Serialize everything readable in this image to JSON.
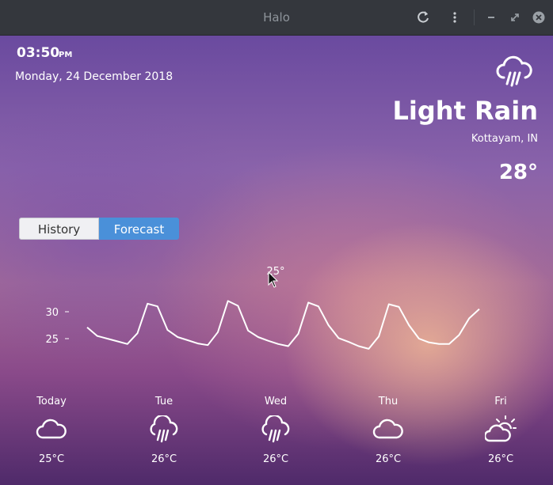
{
  "window": {
    "title": "Halo"
  },
  "header": {
    "time": "03:50",
    "ampm": "PM",
    "date": "Monday, 24 December 2018",
    "condition": "Light Rain",
    "location": "Kottayam, IN",
    "temperature": "28°",
    "condition_icon": "rain-cloud-icon"
  },
  "tabs": [
    {
      "label": "History",
      "active": false
    },
    {
      "label": "Forecast",
      "active": true
    }
  ],
  "chart_data": {
    "type": "line",
    "title": "",
    "xlabel": "",
    "ylabel": "",
    "yticks": [
      "30",
      "25"
    ],
    "ylim": [
      20,
      33
    ],
    "hover_label": "25°",
    "series": [
      {
        "values": [
          27.1,
          25.5,
          25.0,
          24.5,
          24.0,
          26.0,
          31.5,
          31.0,
          26.6,
          25.3,
          24.7,
          24.1,
          23.8,
          26.2,
          32.0,
          31.1,
          26.5,
          25.3,
          24.6,
          24.0,
          23.6,
          25.9,
          31.7,
          31.0,
          27.5,
          25.1,
          24.4,
          23.6,
          23.1,
          25.4,
          31.4,
          30.9,
          27.5,
          25.0,
          24.3,
          24.0,
          24.0,
          25.7,
          28.8,
          30.5
        ]
      }
    ]
  },
  "forecast": [
    {
      "day": "Today",
      "icon": "cloud-icon",
      "temp": "25°C"
    },
    {
      "day": "Tue",
      "icon": "rain-cloud-icon",
      "temp": "26°C"
    },
    {
      "day": "Wed",
      "icon": "rain-cloud-icon",
      "temp": "26°C"
    },
    {
      "day": "Thu",
      "icon": "cloud-icon",
      "temp": "26°C"
    },
    {
      "day": "Fri",
      "icon": "partly-cloudy-day-icon",
      "temp": "26°C"
    }
  ]
}
